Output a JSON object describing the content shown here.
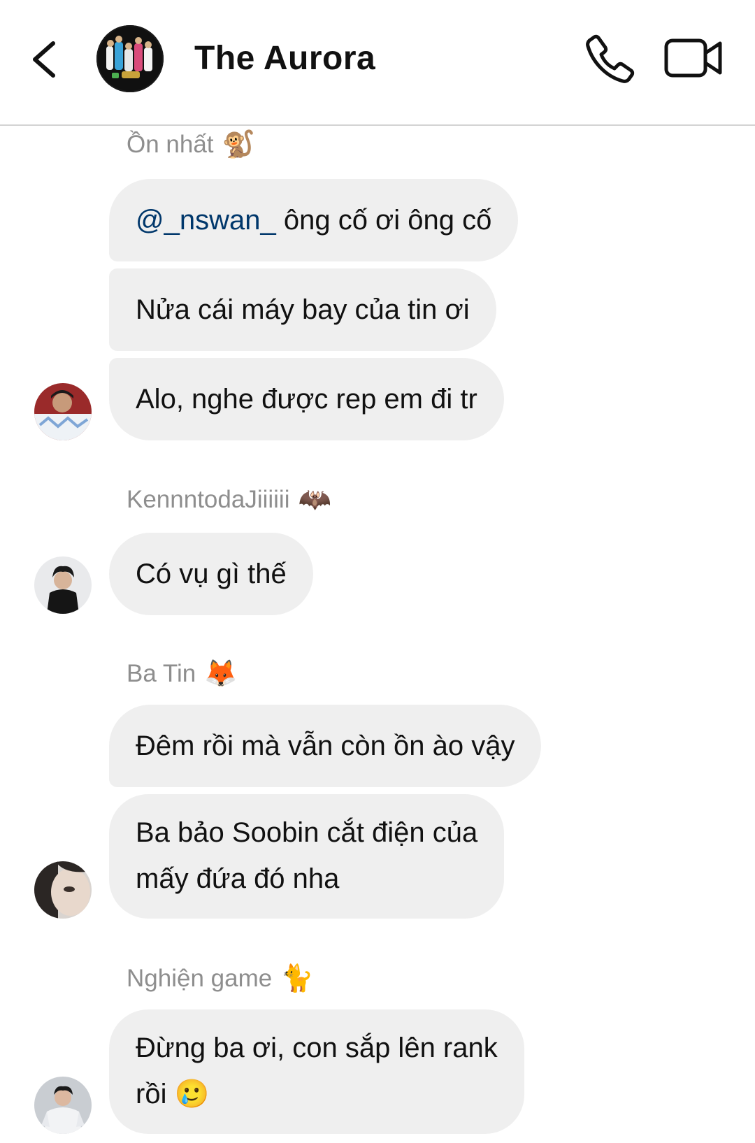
{
  "header": {
    "title": "The Aurora"
  },
  "messages": [
    {
      "sender": "Ồn nhất",
      "sender_emoji": "🐒",
      "bubbles": [
        {
          "mention": "@_nswan_",
          "text": " ông cố ơi ông cố"
        },
        {
          "text": "Nửa cái máy bay của tin ơi"
        },
        {
          "text": "Alo, nghe được rep em đi tr"
        }
      ]
    },
    {
      "sender": "KennntodaJiiiiii",
      "sender_emoji": "🦇",
      "bubbles": [
        {
          "text": "Có vụ gì thế"
        }
      ]
    },
    {
      "sender": "Ba Tin",
      "sender_emoji": "🦊",
      "bubbles": [
        {
          "text": "Đêm rồi mà vẫn còn ồn ào vậy"
        },
        {
          "line1": "Ba bảo Soobin cắt điện của",
          "line2": "mấy đứa đó nha"
        }
      ]
    },
    {
      "sender": "Nghiện game",
      "sender_emoji": "🐈",
      "bubbles": [
        {
          "line1": "Đừng ba ơi, con sắp lên rank",
          "line2": "rồi",
          "line2_emoji": "🥲"
        }
      ]
    }
  ],
  "colors": {
    "bubble_bg": "#efefef",
    "mention": "#00376b",
    "sender_name": "#8e8e8e",
    "divider": "#d3d3d3"
  },
  "icons": {
    "back": "chevron-left-icon",
    "call": "phone-icon",
    "video": "video-camera-icon"
  }
}
